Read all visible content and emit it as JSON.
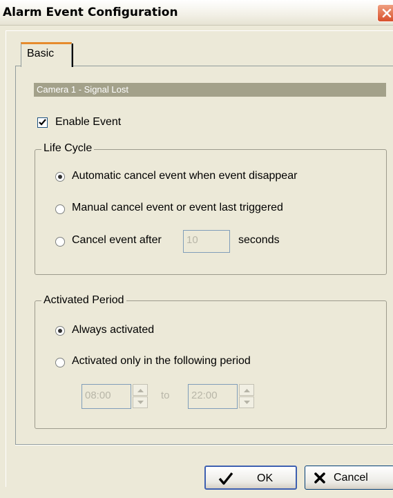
{
  "window": {
    "title": "Alarm Event Configuration",
    "close_icon": "close-icon"
  },
  "tabs": [
    {
      "label": "Basic",
      "selected": true
    }
  ],
  "event": {
    "camera_label": "Camera 1 - Signal Lost",
    "enable_label": "Enable Event",
    "enabled": true
  },
  "life_cycle": {
    "legend": "Life Cycle",
    "options": [
      {
        "label": "Automatic cancel event when event disappear",
        "selected": true
      },
      {
        "label": "Manual cancel event or event last triggered",
        "selected": false
      },
      {
        "label": "Cancel event after",
        "selected": false
      }
    ],
    "cancel_seconds_value": "10",
    "seconds_label": "seconds"
  },
  "activated_period": {
    "legend": "Activated Period",
    "options": [
      {
        "label": "Always activated",
        "selected": true
      },
      {
        "label": "Activated only in the following period",
        "selected": false
      }
    ],
    "start_time": "08:00",
    "to_label": "to",
    "end_time": "22:00"
  },
  "buttons": {
    "ok_label": "OK",
    "cancel_label": "Cancel"
  },
  "colors": {
    "window_bg": "#ece9d8",
    "camera_bar_bg": "#a3a18a",
    "tab_accent": "#e68b2c",
    "close_red": "#d8502b"
  }
}
